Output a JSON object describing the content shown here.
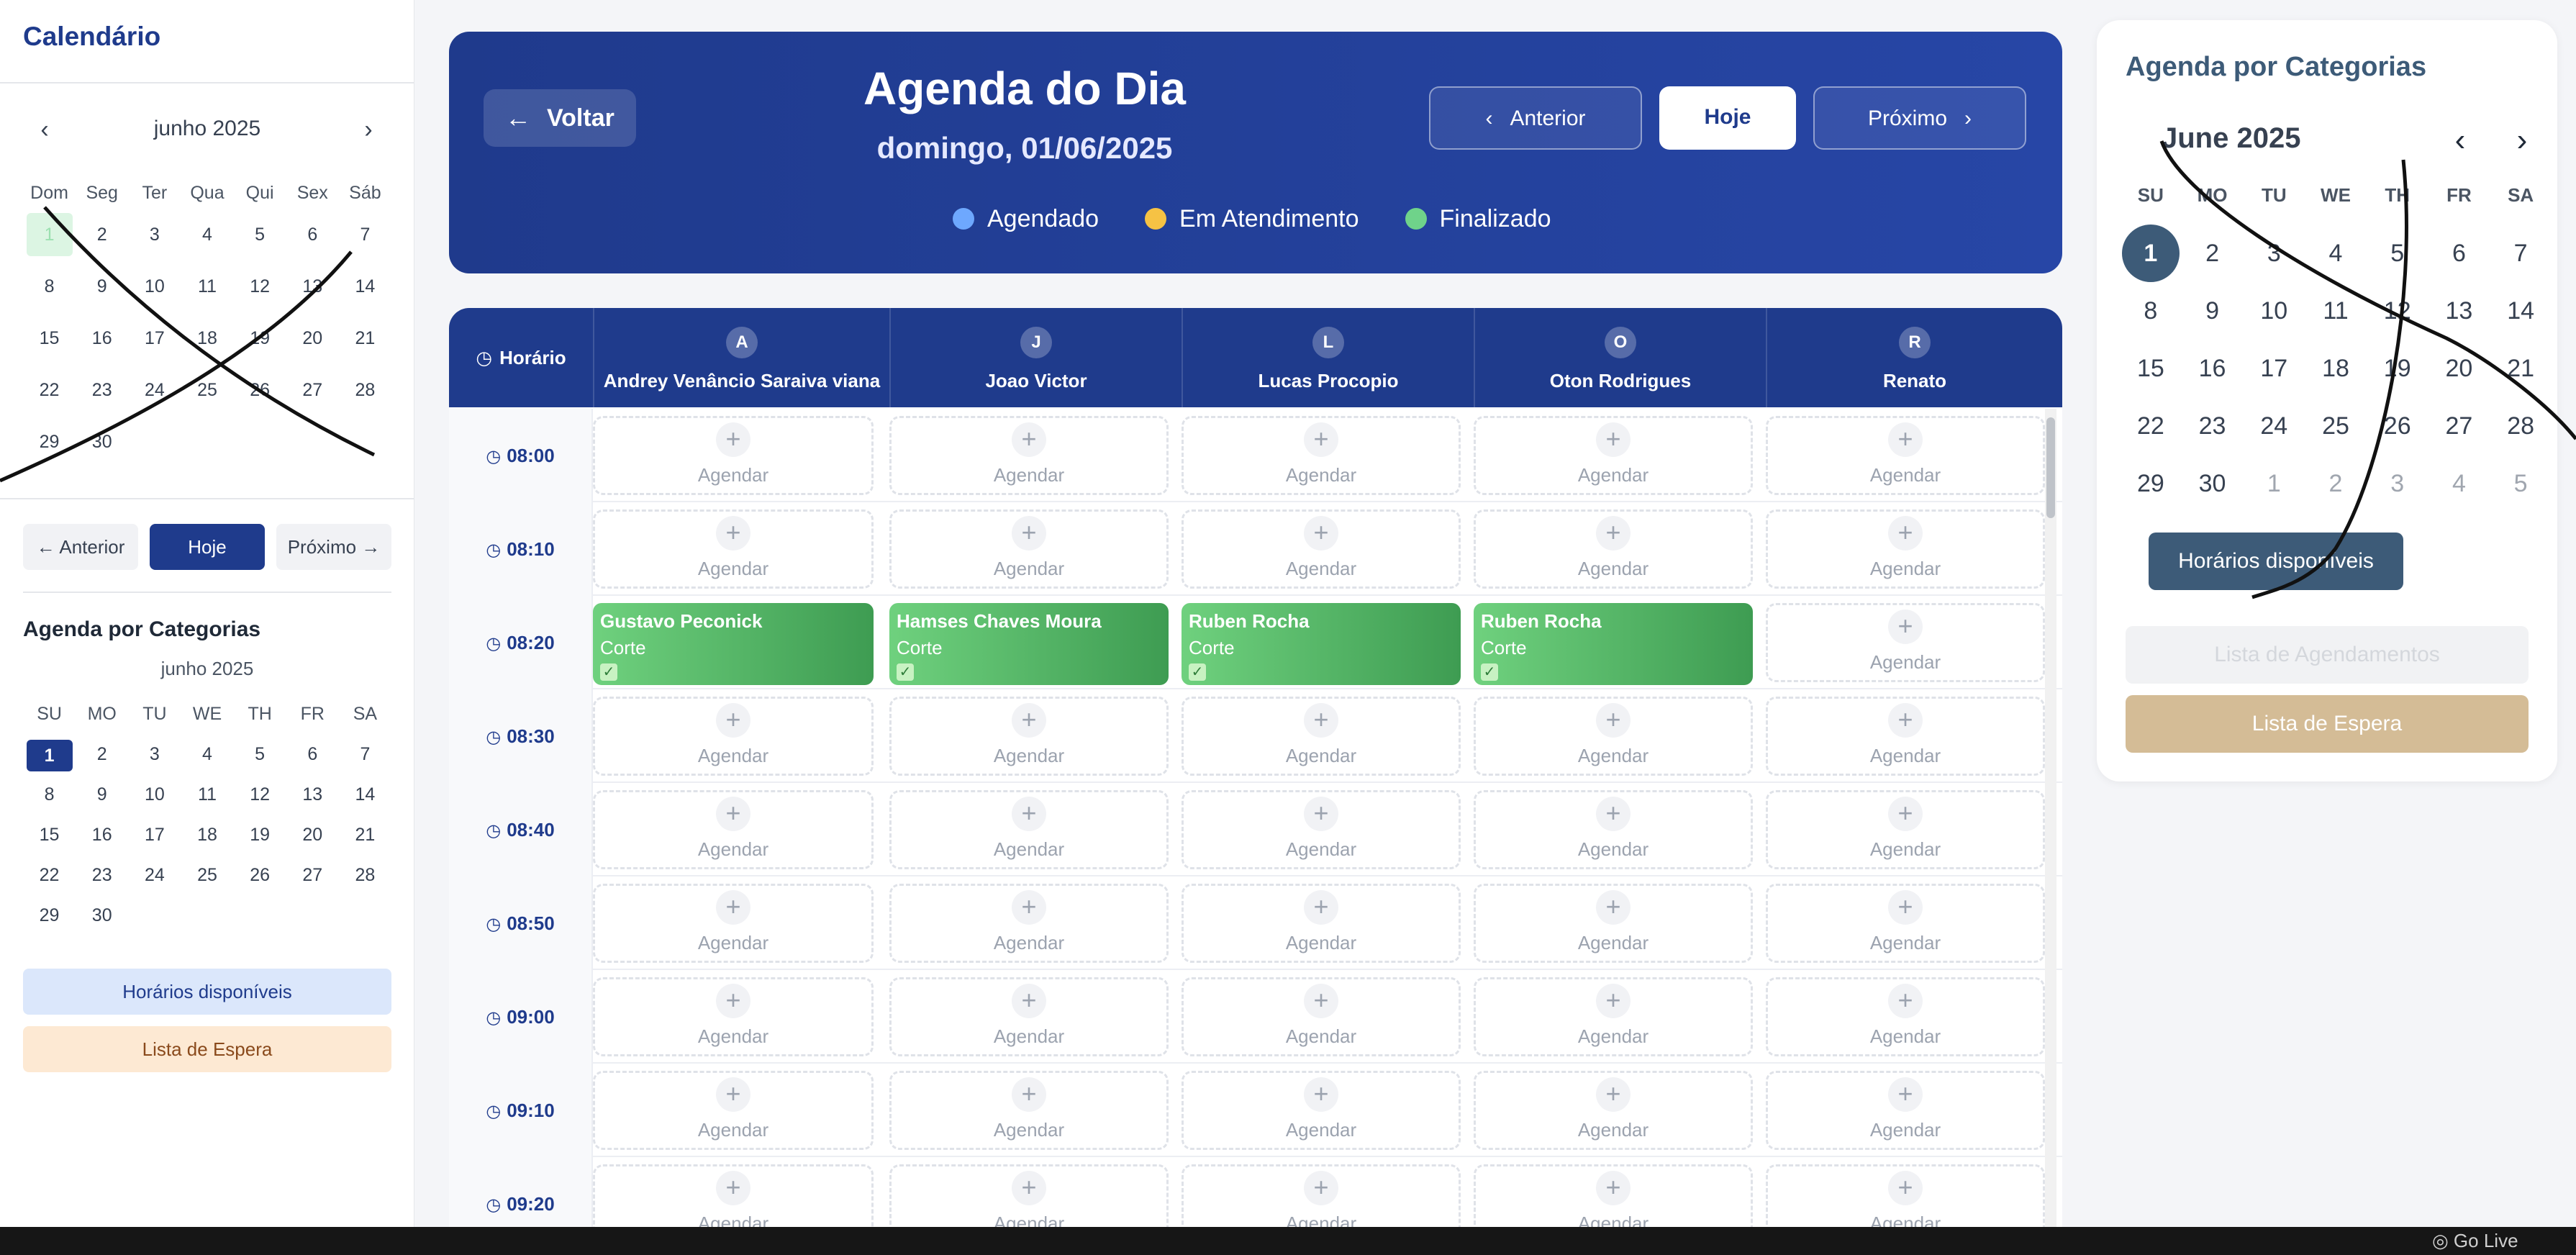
{
  "sidebar": {
    "title": "Calendário",
    "month": "junho 2025",
    "prev": "‹",
    "next": "›",
    "dow": [
      "Dom",
      "Seg",
      "Ter",
      "Qua",
      "Qui",
      "Sex",
      "Sáb"
    ],
    "weeks": [
      [
        "1",
        "2",
        "3",
        "4",
        "5",
        "6",
        "7"
      ],
      [
        "8",
        "9",
        "10",
        "11",
        "12",
        "13",
        "14"
      ],
      [
        "15",
        "16",
        "17",
        "18",
        "19",
        "20",
        "21"
      ],
      [
        "22",
        "23",
        "24",
        "25",
        "26",
        "27",
        "28"
      ],
      [
        "29",
        "30",
        "",
        "",
        "",
        "",
        ""
      ]
    ],
    "btn_prev": "← Anterior",
    "btn_today": "Hoje",
    "btn_next": "Próximo →",
    "categories_title": "Agenda por Categorias",
    "categories_month": "junho 2025",
    "categories_dow": [
      "SU",
      "MO",
      "TU",
      "WE",
      "TH",
      "FR",
      "SA"
    ],
    "categories_weeks": [
      [
        "1",
        "2",
        "3",
        "4",
        "5",
        "6",
        "7"
      ],
      [
        "8",
        "9",
        "10",
        "11",
        "12",
        "13",
        "14"
      ],
      [
        "15",
        "16",
        "17",
        "18",
        "19",
        "20",
        "21"
      ],
      [
        "22",
        "23",
        "24",
        "25",
        "26",
        "27",
        "28"
      ],
      [
        "29",
        "30",
        "",
        "",
        "",
        "",
        ""
      ]
    ],
    "btn_available": "Horários disponíveis",
    "btn_waitlist": "Lista de Espera"
  },
  "header": {
    "back": "Voltar",
    "title": "Agenda do Dia",
    "date": "domingo, 01/06/2025",
    "prev": "Anterior",
    "today": "Hoje",
    "next": "Próximo",
    "legend": [
      {
        "label": "Agendado",
        "color": "#6ea8fe"
      },
      {
        "label": "Em Atendimento",
        "color": "#f6c244"
      },
      {
        "label": "Finalizado",
        "color": "#6fd38a"
      }
    ]
  },
  "table": {
    "time_header": "Horário",
    "professionals": [
      {
        "initial": "A",
        "name": "Andrey Venâncio Saraiva viana"
      },
      {
        "initial": "J",
        "name": "Joao Victor"
      },
      {
        "initial": "L",
        "name": "Lucas Procopio"
      },
      {
        "initial": "O",
        "name": "Oton Rodrigues"
      },
      {
        "initial": "R",
        "name": "Renato"
      }
    ],
    "slot_label": "Agendar",
    "times": [
      "08:00",
      "08:10",
      "08:20",
      "08:30",
      "08:40",
      "08:50",
      "09:00",
      "09:10",
      "09:20"
    ],
    "appointments": [
      {
        "time": "08:20",
        "column": 0,
        "client": "Gustavo Peconick",
        "service": "Corte"
      },
      {
        "time": "08:20",
        "column": 1,
        "client": "Hamses Chaves Moura",
        "service": "Corte"
      },
      {
        "time": "08:20",
        "column": 2,
        "client": "Ruben Rocha",
        "service": "Corte"
      },
      {
        "time": "08:20",
        "column": 3,
        "client": "Ruben Rocha",
        "service": "Corte"
      }
    ]
  },
  "right_panel": {
    "title": "Agenda por Categorias",
    "month": "June 2025",
    "dow": [
      "SU",
      "MO",
      "TU",
      "WE",
      "TH",
      "FR",
      "SA"
    ],
    "weeks": [
      [
        "1",
        "2",
        "3",
        "4",
        "5",
        "6",
        "7"
      ],
      [
        "8",
        "9",
        "10",
        "11",
        "12",
        "13",
        "14"
      ],
      [
        "15",
        "16",
        "17",
        "18",
        "19",
        "20",
        "21"
      ],
      [
        "22",
        "23",
        "24",
        "25",
        "26",
        "27",
        "28"
      ],
      [
        "29",
        "30",
        "1",
        "2",
        "3",
        "4",
        "5"
      ]
    ],
    "btn_available": "Horários disponíveis",
    "btn_list": "Lista de Agendamentos",
    "btn_waitlist": "Lista de Espera"
  },
  "taskbar": {
    "go_live": "Go Live"
  },
  "colors": {
    "primary": "#1f3b8c",
    "finalizado": "#4caf62",
    "accent_slate": "#3d5b78",
    "waitlist": "#d4bc96"
  }
}
